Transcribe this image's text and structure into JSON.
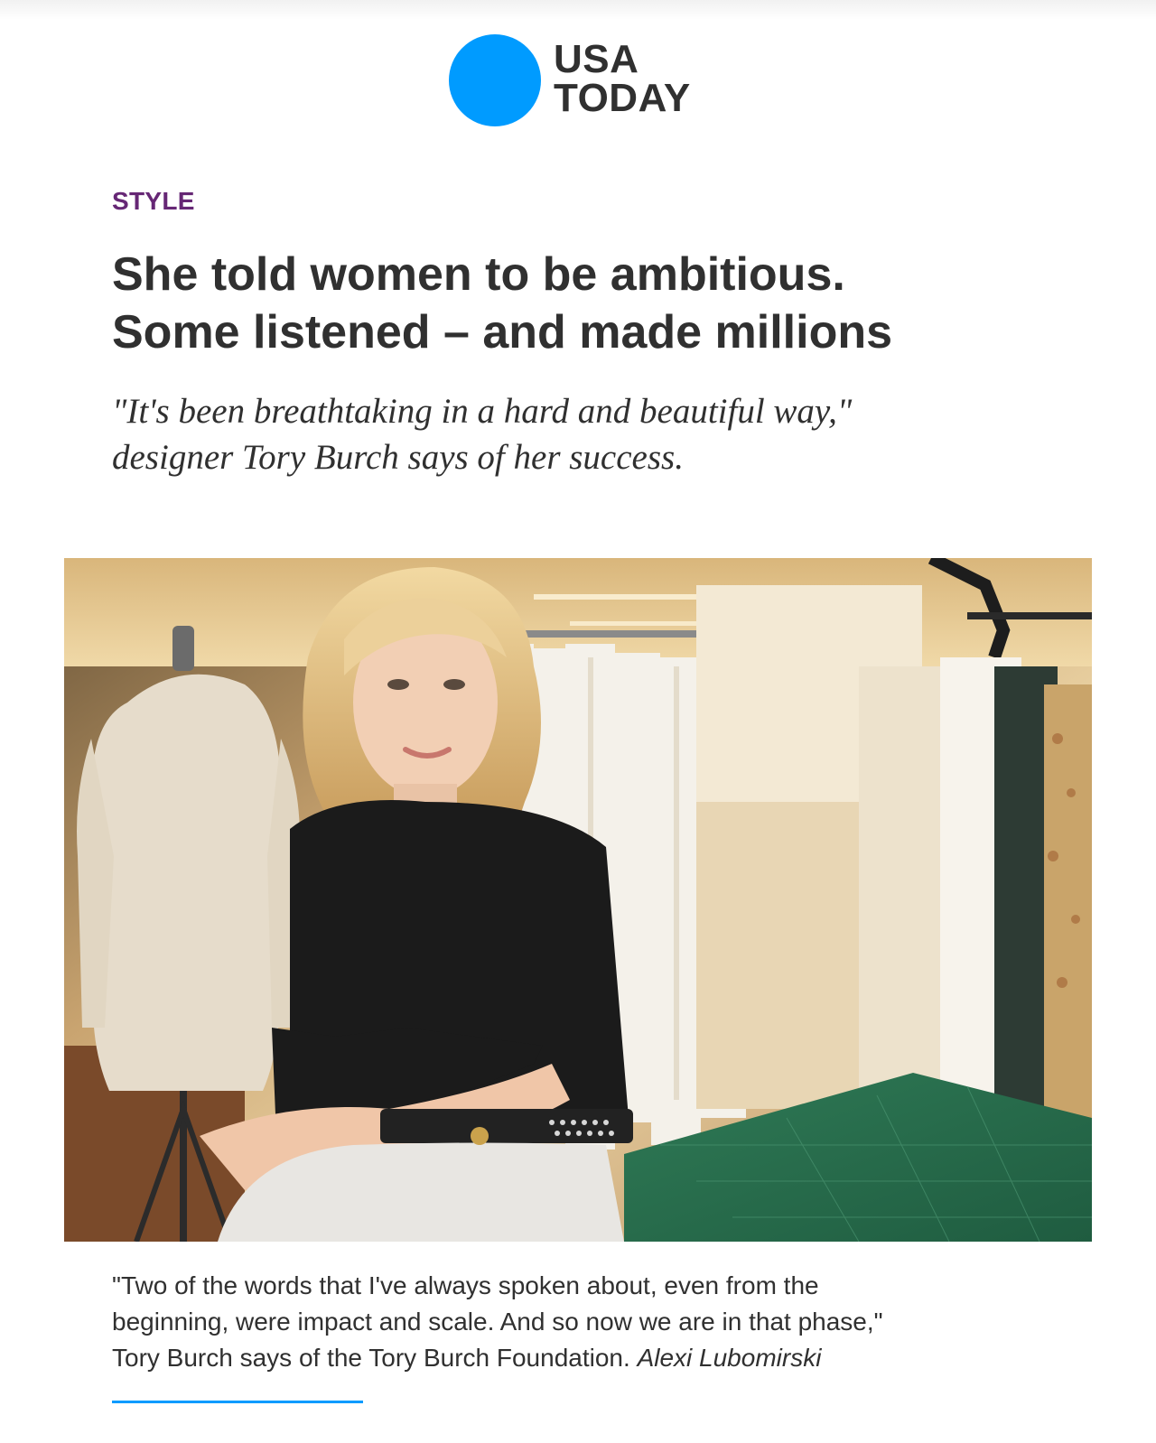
{
  "brand": {
    "line1": "USA",
    "line2": "TODAY",
    "accent_color": "#009bff"
  },
  "article": {
    "section": "STYLE",
    "section_color": "#662775",
    "headline_line1": "She told women to be ambitious.",
    "headline_line2": "Some listened – and made millions",
    "dek_line1": "\"It's been breathtaking in a hard and beautiful way,\"",
    "dek_line2": "designer Tory Burch says of her success.",
    "caption_line1": "\"Two of the words that I've always spoken about, even from the",
    "caption_line2": "beginning, were impact and scale. And so now we are in that phase,\"",
    "caption_line3": "Tory Burch says of the Tory Burch Foundation.",
    "photo_credit": "Alexi Lubomirski"
  }
}
